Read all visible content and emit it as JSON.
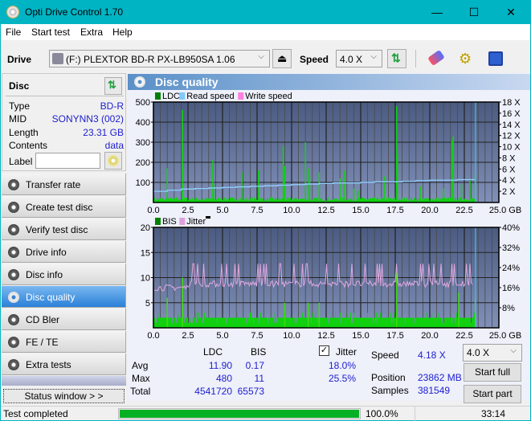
{
  "window": {
    "title": "Opti Drive Control 1.70",
    "minimize": "—",
    "maximize": "☐",
    "close": "✕"
  },
  "menu": [
    "File",
    "Start test",
    "Extra",
    "Help"
  ],
  "toolbar": {
    "drive_label": "Drive",
    "drive_value": "(F:)  PLEXTOR BD-R  PX-LB950SA 1.06",
    "speed_label": "Speed",
    "speed_value": "4.0 X"
  },
  "disc": {
    "header": "Disc",
    "rows": [
      {
        "key": "Type",
        "value": "BD-R"
      },
      {
        "key": "MID",
        "value": "SONYNN3 (002)"
      },
      {
        "key": "Length",
        "value": "23.31 GB"
      },
      {
        "key": "Contents",
        "value": "data"
      }
    ],
    "label_key": "Label",
    "label_value": ""
  },
  "nav": [
    {
      "label": "Transfer rate",
      "active": false
    },
    {
      "label": "Create test disc",
      "active": false
    },
    {
      "label": "Verify test disc",
      "active": false
    },
    {
      "label": "Drive info",
      "active": false
    },
    {
      "label": "Disc info",
      "active": false
    },
    {
      "label": "Disc quality",
      "active": true
    },
    {
      "label": "CD Bler",
      "active": false
    },
    {
      "label": "FE / TE",
      "active": false
    },
    {
      "label": "Extra tests",
      "active": false
    }
  ],
  "status_window_label": "Status window > >",
  "panel_title": "Disc quality",
  "chart_data": [
    {
      "type": "bar",
      "title": "",
      "legend": [
        "LDC",
        "Read speed",
        "Write speed"
      ],
      "legend_colors": [
        "#008000",
        "#80c8ff",
        "#ff80e0"
      ],
      "legend_placement": "top-left",
      "x_ticks": [
        "0.0",
        "2.5",
        "5.0",
        "7.5",
        "10.0",
        "12.5",
        "15.0",
        "17.5",
        "20.0",
        "22.5",
        "25.0 GB"
      ],
      "xlim": [
        0,
        25
      ],
      "y_ticks": [
        100,
        200,
        300,
        400,
        500
      ],
      "ylim": [
        0,
        500
      ],
      "y2_ticks": [
        "2 X",
        "4 X",
        "6 X",
        "8 X",
        "10 X",
        "12 X",
        "14 X",
        "16 X",
        "18 X"
      ],
      "y2lim": [
        0,
        18
      ],
      "grid": true,
      "ldc_spikes": [
        [
          1.0,
          170
        ],
        [
          2.1,
          460
        ],
        [
          4.3,
          210
        ],
        [
          4.35,
          90
        ],
        [
          6.4,
          150
        ],
        [
          7.6,
          160
        ],
        [
          9.4,
          280
        ],
        [
          9.5,
          180
        ],
        [
          11.0,
          300
        ],
        [
          11.25,
          170
        ],
        [
          11.3,
          130
        ],
        [
          12.0,
          150
        ],
        [
          13.5,
          120
        ],
        [
          13.8,
          160
        ],
        [
          14.5,
          70
        ],
        [
          14.8,
          60
        ],
        [
          16.7,
          130
        ],
        [
          17.6,
          480
        ],
        [
          17.65,
          240
        ],
        [
          19.3,
          80
        ],
        [
          21.0,
          70
        ],
        [
          21.6,
          310
        ],
        [
          21.7,
          330
        ],
        [
          22.3,
          90
        ],
        [
          22.9,
          110
        ],
        [
          23.3,
          150
        ]
      ],
      "ldc_baseline": 20,
      "read_speed": [
        [
          0,
          2.0
        ],
        [
          1,
          2.2
        ],
        [
          2,
          2.4
        ],
        [
          3,
          2.5
        ],
        [
          4,
          2.6
        ],
        [
          5,
          2.7
        ],
        [
          6,
          2.8
        ],
        [
          7,
          2.9
        ],
        [
          8,
          3.0
        ],
        [
          9,
          3.1
        ],
        [
          10,
          3.2
        ],
        [
          11,
          3.3
        ],
        [
          12,
          3.4
        ],
        [
          13,
          3.5
        ],
        [
          14,
          3.5
        ],
        [
          15,
          3.6
        ],
        [
          16,
          3.7
        ],
        [
          17,
          3.7
        ],
        [
          18,
          3.8
        ],
        [
          19,
          3.9
        ],
        [
          20,
          4.0
        ],
        [
          21,
          4.0
        ],
        [
          22,
          4.1
        ],
        [
          23.3,
          4.2
        ]
      ],
      "end_marker_x": 23.31
    },
    {
      "type": "bar",
      "title": "",
      "legend": [
        "BIS",
        "Jitter"
      ],
      "legend_colors": [
        "#008000",
        "#e0a0e0"
      ],
      "legend_placement": "top-left",
      "x_ticks": [
        "0.0",
        "2.5",
        "5.0",
        "7.5",
        "10.0",
        "12.5",
        "15.0",
        "17.5",
        "20.0",
        "22.5",
        "25.0 GB"
      ],
      "xlim": [
        0,
        25
      ],
      "y_ticks": [
        5,
        10,
        15,
        20
      ],
      "ylim": [
        0,
        20
      ],
      "y2_ticks": [
        "8%",
        "16%",
        "24%",
        "32%",
        "40%"
      ],
      "y2lim": [
        0,
        40
      ],
      "grid": true,
      "bis_spikes": [
        [
          1.0,
          6
        ],
        [
          2.1,
          10
        ],
        [
          9.5,
          5
        ],
        [
          11.2,
          5
        ],
        [
          12.0,
          5
        ],
        [
          17.6,
          11
        ],
        [
          22.1,
          7
        ],
        [
          23.3,
          6
        ]
      ],
      "bis_baseline": 2,
      "jitter_base_pct": 17.5,
      "jitter_peak_pct": 25.5,
      "end_marker_x": 23.31
    }
  ],
  "stats": {
    "col_ldc": "LDC",
    "col_bis": "BIS",
    "jitter_label": "Jitter",
    "jitter_checked": true,
    "rows": [
      {
        "label": "Avg",
        "ldc": "11.90",
        "bis": "0.17",
        "jitter": "18.0%"
      },
      {
        "label": "Max",
        "ldc": "480",
        "bis": "11",
        "jitter": "25.5%"
      },
      {
        "label": "Total",
        "ldc": "4541720",
        "bis": "65573",
        "jitter": ""
      }
    ],
    "speed_label": "Speed",
    "speed_value": "4.18 X",
    "position_label": "Position",
    "position_value": "23862 MB",
    "samples_label": "Samples",
    "samples_value": "381549",
    "speed_select": "4.0 X",
    "start_full": "Start full",
    "start_part": "Start part"
  },
  "statusbar": {
    "text": "Test completed",
    "progress": 1.0,
    "progress_text": "100.0%",
    "time": "33:14"
  }
}
